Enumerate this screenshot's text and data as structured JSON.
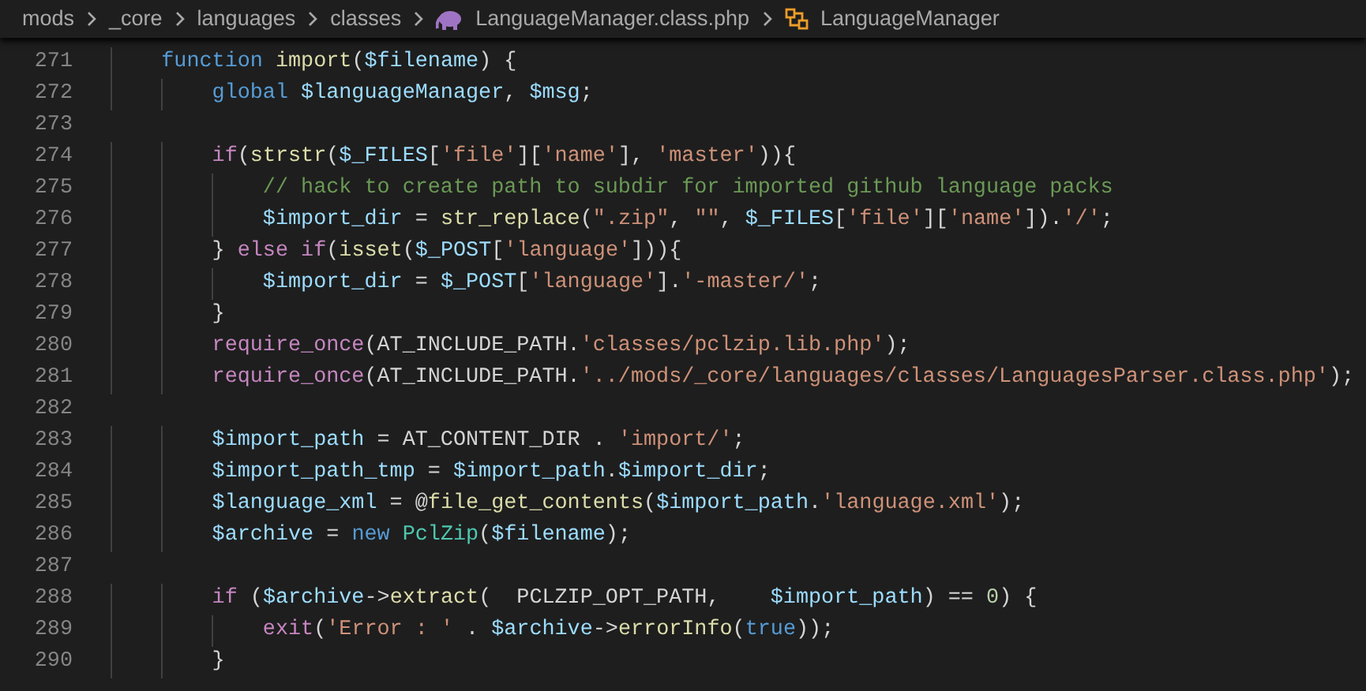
{
  "breadcrumb": [
    {
      "label": "mods",
      "kind": "folder"
    },
    {
      "label": "_core",
      "kind": "folder"
    },
    {
      "label": "languages",
      "kind": "folder"
    },
    {
      "label": "classes",
      "kind": "folder"
    },
    {
      "label": "LanguageManager.class.php",
      "kind": "file"
    },
    {
      "label": "LanguageManager",
      "kind": "class"
    }
  ],
  "lines": [
    {
      "number": "271",
      "tokens": [
        {
          "kind": "kw",
          "text": "    function"
        },
        {
          "kind": "fn",
          "text": " import"
        },
        {
          "kind": "plain",
          "text": "("
        },
        {
          "kind": "var",
          "text": "$filename"
        },
        {
          "kind": "plain",
          "text": ") {"
        }
      ]
    },
    {
      "number": "272",
      "tokens": [
        {
          "kind": "kw",
          "text": "        global"
        },
        {
          "kind": "var",
          "text": " $languageManager"
        },
        {
          "kind": "plain",
          "text": ", "
        },
        {
          "kind": "var",
          "text": "$msg"
        },
        {
          "kind": "plain",
          "text": ";"
        }
      ]
    },
    {
      "number": "273"
    },
    {
      "number": "274",
      "tokens": [
        {
          "kind": "ctrl",
          "text": "        if"
        },
        {
          "kind": "plain",
          "text": "("
        },
        {
          "kind": "fn",
          "text": "strstr"
        },
        {
          "kind": "plain",
          "text": "("
        },
        {
          "kind": "var",
          "text": "$_FILES"
        },
        {
          "kind": "plain",
          "text": "["
        },
        {
          "kind": "str",
          "text": "'file'"
        },
        {
          "kind": "plain",
          "text": "]["
        },
        {
          "kind": "str",
          "text": "'name'"
        },
        {
          "kind": "plain",
          "text": "], "
        },
        {
          "kind": "str",
          "text": "'master'"
        },
        {
          "kind": "plain",
          "text": ")){"
        }
      ]
    },
    {
      "number": "275",
      "tokens": [
        {
          "kind": "cmt",
          "text": "            // hack to create path to subdir for imported github language packs"
        }
      ]
    },
    {
      "number": "276",
      "tokens": [
        {
          "kind": "var",
          "text": "            $import_dir"
        },
        {
          "kind": "plain",
          "text": " = "
        },
        {
          "kind": "fn",
          "text": "str_replace"
        },
        {
          "kind": "plain",
          "text": "("
        },
        {
          "kind": "str",
          "text": "\".zip\""
        },
        {
          "kind": "plain",
          "text": ", "
        },
        {
          "kind": "str",
          "text": "\"\""
        },
        {
          "kind": "plain",
          "text": ", "
        },
        {
          "kind": "var",
          "text": "$_FILES"
        },
        {
          "kind": "plain",
          "text": "["
        },
        {
          "kind": "str",
          "text": "'file'"
        },
        {
          "kind": "plain",
          "text": "]["
        },
        {
          "kind": "str",
          "text": "'name'"
        },
        {
          "kind": "plain",
          "text": "])."
        },
        {
          "kind": "str",
          "text": "'/'"
        },
        {
          "kind": "plain",
          "text": ";"
        }
      ]
    },
    {
      "number": "277",
      "tokens": [
        {
          "kind": "plain",
          "text": "        } "
        },
        {
          "kind": "ctrl",
          "text": "else if"
        },
        {
          "kind": "plain",
          "text": "("
        },
        {
          "kind": "fn",
          "text": "isset"
        },
        {
          "kind": "plain",
          "text": "("
        },
        {
          "kind": "var",
          "text": "$_POST"
        },
        {
          "kind": "plain",
          "text": "["
        },
        {
          "kind": "str",
          "text": "'language'"
        },
        {
          "kind": "plain",
          "text": "])){"
        }
      ]
    },
    {
      "number": "278",
      "tokens": [
        {
          "kind": "var",
          "text": "            $import_dir"
        },
        {
          "kind": "plain",
          "text": " = "
        },
        {
          "kind": "var",
          "text": "$_POST"
        },
        {
          "kind": "plain",
          "text": "["
        },
        {
          "kind": "str",
          "text": "'language'"
        },
        {
          "kind": "plain",
          "text": "]."
        },
        {
          "kind": "str",
          "text": "'-master/'"
        },
        {
          "kind": "plain",
          "text": ";"
        }
      ]
    },
    {
      "number": "279",
      "tokens": [
        {
          "kind": "plain",
          "text": "        }"
        }
      ]
    },
    {
      "number": "280",
      "tokens": [
        {
          "kind": "ctrl",
          "text": "        require_once"
        },
        {
          "kind": "plain",
          "text": "(AT_INCLUDE_PATH."
        },
        {
          "kind": "str",
          "text": "'classes/pclzip.lib.php'"
        },
        {
          "kind": "plain",
          "text": ");"
        }
      ]
    },
    {
      "number": "281",
      "tokens": [
        {
          "kind": "ctrl",
          "text": "        require_once"
        },
        {
          "kind": "plain",
          "text": "(AT_INCLUDE_PATH."
        },
        {
          "kind": "str",
          "text": "'../mods/_core/languages/classes/LanguagesParser.class.php'"
        },
        {
          "kind": "plain",
          "text": ");"
        }
      ]
    },
    {
      "number": "282"
    },
    {
      "number": "283",
      "tokens": [
        {
          "kind": "var",
          "text": "        $import_path"
        },
        {
          "kind": "plain",
          "text": " = AT_CONTENT_DIR . "
        },
        {
          "kind": "str",
          "text": "'import/'"
        },
        {
          "kind": "plain",
          "text": ";"
        }
      ]
    },
    {
      "number": "284",
      "tokens": [
        {
          "kind": "var",
          "text": "        $import_path_tmp"
        },
        {
          "kind": "plain",
          "text": " = "
        },
        {
          "kind": "var",
          "text": "$import_path"
        },
        {
          "kind": "plain",
          "text": "."
        },
        {
          "kind": "var",
          "text": "$import_dir"
        },
        {
          "kind": "plain",
          "text": ";"
        }
      ]
    },
    {
      "number": "285",
      "tokens": [
        {
          "kind": "var",
          "text": "        $language_xml"
        },
        {
          "kind": "plain",
          "text": " = @"
        },
        {
          "kind": "fn",
          "text": "file_get_contents"
        },
        {
          "kind": "plain",
          "text": "("
        },
        {
          "kind": "var",
          "text": "$import_path"
        },
        {
          "kind": "plain",
          "text": "."
        },
        {
          "kind": "str",
          "text": "'language.xml'"
        },
        {
          "kind": "plain",
          "text": ");"
        }
      ]
    },
    {
      "number": "286",
      "tokens": [
        {
          "kind": "var",
          "text": "        $archive"
        },
        {
          "kind": "plain",
          "text": " = "
        },
        {
          "kind": "kw",
          "text": "new"
        },
        {
          "kind": "cls",
          "text": " PclZip"
        },
        {
          "kind": "plain",
          "text": "("
        },
        {
          "kind": "var",
          "text": "$filename"
        },
        {
          "kind": "plain",
          "text": ");"
        }
      ]
    },
    {
      "number": "287"
    },
    {
      "number": "288",
      "tokens": [
        {
          "kind": "ctrl",
          "text": "        if"
        },
        {
          "kind": "plain",
          "text": " ("
        },
        {
          "kind": "var",
          "text": "$archive"
        },
        {
          "kind": "plain",
          "text": "->"
        },
        {
          "kind": "fn",
          "text": "extract"
        },
        {
          "kind": "plain",
          "text": "(  PCLZIP_OPT_PATH,    "
        },
        {
          "kind": "var",
          "text": "$import_path"
        },
        {
          "kind": "plain",
          "text": ") == "
        },
        {
          "kind": "num",
          "text": "0"
        },
        {
          "kind": "plain",
          "text": ") {"
        }
      ]
    },
    {
      "number": "289",
      "tokens": [
        {
          "kind": "ctrl",
          "text": "            exit"
        },
        {
          "kind": "plain",
          "text": "("
        },
        {
          "kind": "str",
          "text": "'Error : '"
        },
        {
          "kind": "plain",
          "text": " . "
        },
        {
          "kind": "var",
          "text": "$archive"
        },
        {
          "kind": "plain",
          "text": "->"
        },
        {
          "kind": "fn",
          "text": "errorInfo"
        },
        {
          "kind": "plain",
          "text": "("
        },
        {
          "kind": "kw",
          "text": "true"
        },
        {
          "kind": "plain",
          "text": "));"
        }
      ]
    },
    {
      "number": "290",
      "tokens": [
        {
          "kind": "plain",
          "text": "        }"
        }
      ]
    }
  ]
}
